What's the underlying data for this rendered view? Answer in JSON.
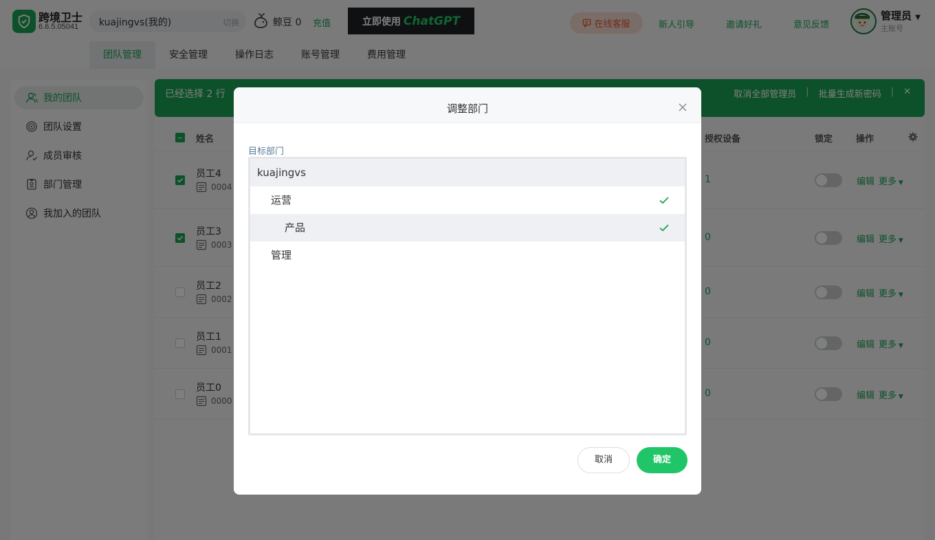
{
  "app": {
    "name": "跨境卫士",
    "version": "6.6.5.05041"
  },
  "header": {
    "team_name": "kuajingvs(我的)",
    "switch_label": "切换",
    "bean_label": "鲸豆 0",
    "recharge_label": "充值",
    "ad_text_1": "立即使用",
    "ad_text_2": "ChatGPT",
    "service_label": "在线客服",
    "links": [
      "新人引导",
      "邀请好礼",
      "意见反馈"
    ],
    "user_name": "管理员",
    "user_role": "主账号"
  },
  "tabs": [
    "团队管理",
    "安全管理",
    "操作日志",
    "账号管理",
    "费用管理"
  ],
  "sidebar": {
    "items": [
      "我的团队",
      "团队设置",
      "成员审核",
      "部门管理",
      "我加入的团队"
    ]
  },
  "selection_bar": {
    "selected_text": "已经选择 2 行",
    "action_1": "取消全部管理员",
    "action_2": "批量生成新密码",
    "separator": "|",
    "close": "✕"
  },
  "table": {
    "headers": {
      "name": "姓名",
      "devices": "授权设备",
      "lock": "锁定",
      "ops": "操作"
    },
    "rows": [
      {
        "name": "员工4",
        "code": "0004",
        "devices": "1",
        "checked": true
      },
      {
        "name": "员工3",
        "code": "0003",
        "devices": "0",
        "checked": true
      },
      {
        "name": "员工2",
        "code": "0002",
        "devices": "0",
        "checked": false
      },
      {
        "name": "员工1",
        "code": "0001",
        "devices": "0",
        "checked": false
      },
      {
        "name": "员工0",
        "code": "0000",
        "devices": "0",
        "checked": false
      }
    ],
    "edit_label": "编辑",
    "more_label": "更多"
  },
  "modal": {
    "title": "调整部门",
    "field_label": "目标部门",
    "tree": [
      {
        "label": "kuajingvs",
        "level": 0,
        "checked": false,
        "highlight": true
      },
      {
        "label": "运营",
        "level": 1,
        "checked": true,
        "highlight": false
      },
      {
        "label": "产品",
        "level": 2,
        "checked": true,
        "highlight": true
      },
      {
        "label": "管理",
        "level": 1,
        "checked": false,
        "highlight": false
      }
    ],
    "cancel_label": "取消",
    "ok_label": "确定"
  },
  "colors": {
    "brand": "#1aa355",
    "button": "#20c567",
    "danger": "#e4572e"
  }
}
